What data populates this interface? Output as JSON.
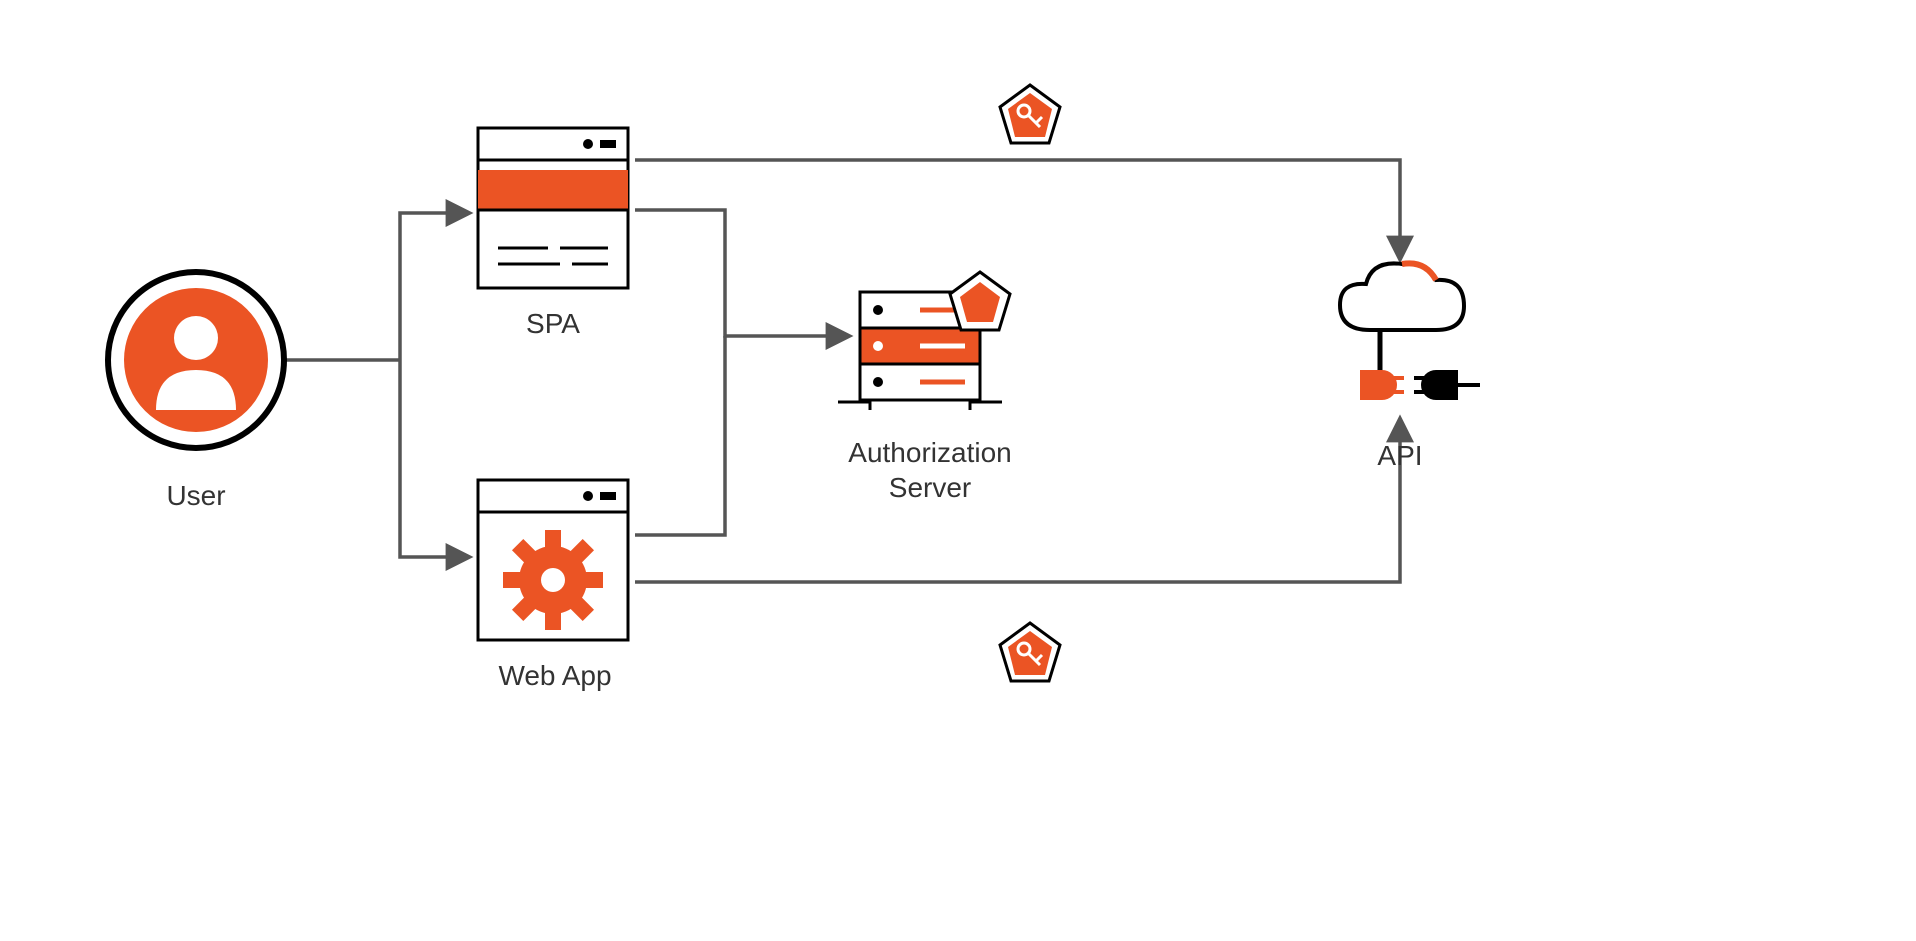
{
  "nodes": {
    "user": {
      "label": "User"
    },
    "spa": {
      "label": "SPA"
    },
    "webapp": {
      "label": "Web App"
    },
    "auth_server": {
      "label": "Authorization\nServer"
    },
    "api": {
      "label": "API"
    }
  },
  "icons": {
    "token_top": "key-pentagon-icon",
    "token_bottom": "key-pentagon-icon"
  },
  "colors": {
    "accent": "#eb5424",
    "stroke": "#555555",
    "black": "#000000",
    "white": "#ffffff"
  }
}
